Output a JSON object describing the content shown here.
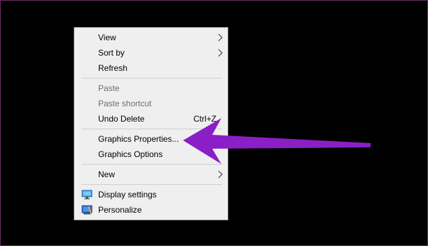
{
  "context_menu": {
    "items": {
      "view": {
        "label": "View"
      },
      "sort_by": {
        "label": "Sort by"
      },
      "refresh": {
        "label": "Refresh"
      },
      "paste": {
        "label": "Paste"
      },
      "paste_shortcut": {
        "label": "Paste shortcut"
      },
      "undo_delete": {
        "label": "Undo Delete",
        "shortcut": "Ctrl+Z"
      },
      "graphics_properties": {
        "label": "Graphics Properties..."
      },
      "graphics_options": {
        "label": "Graphics Options"
      },
      "new": {
        "label": "New"
      },
      "display_settings": {
        "label": "Display settings",
        "icon": "monitor-icon"
      },
      "personalize": {
        "label": "Personalize",
        "icon": "personalize-icon"
      }
    }
  },
  "colors": {
    "background": "#000000",
    "menu_background": "#efefef",
    "disabled_text": "#6d6d6d",
    "annotation_arrow": "#8a1fc7"
  }
}
